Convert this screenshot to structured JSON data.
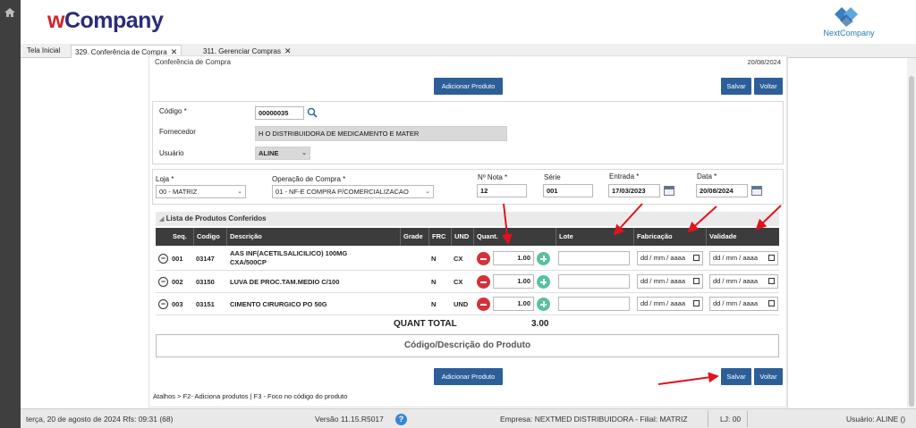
{
  "header": {
    "logo_w": "w",
    "logo_company": "Company",
    "brand_right": "NextCompany"
  },
  "tabs": [
    {
      "label": "Tela Inicial"
    },
    {
      "label": "329. Conferência de Compra"
    },
    {
      "label": "311. Gerenciar Compras"
    }
  ],
  "page": {
    "title": "Conferência de Compra",
    "date": "20/08/2024"
  },
  "buttons": {
    "add_product": "Adicionar Produto",
    "save": "Salvar",
    "back": "Voltar"
  },
  "info": {
    "codigo_label": "Código *",
    "codigo_value": "00000035",
    "fornecedor_label": "Fornecedor",
    "fornecedor_value": "H O DISTRIBUIDORA DE MEDICAMENTO E MATER",
    "usuario_label": "Usuário",
    "usuario_value": "ALINE"
  },
  "form": {
    "loja_label": "Loja *",
    "loja_value": "00 - MATRIZ",
    "operacao_label": "Operação de Compra *",
    "operacao_value": "01 - NF-E COMPRA P/COMERCIALIZACAO",
    "nota_label": "Nº Nota *",
    "nota_value": "12",
    "serie_label": "Série",
    "serie_value": "001",
    "entrada_label": "Entrada *",
    "entrada_value": "17/03/2023",
    "data_label": "Data *",
    "data_value": "20/08/2024"
  },
  "list": {
    "title": "Lista de Produtos Conferidos",
    "columns": [
      "Seq.",
      "Codigo",
      "Descrição",
      "Grade",
      "FRC",
      "UND",
      "Quant.",
      "Lote",
      "Fabricação",
      "Validade"
    ],
    "rows": [
      {
        "seq": "001",
        "codigo": "03147",
        "descricao": "AAS INF(ACETILSALICILICO) 100MG CXA/500CP",
        "frc": "N",
        "und": "CX",
        "quant": "1.00",
        "fabricacao": "dd / mm / aaaa",
        "validade": "dd / mm / aaaa"
      },
      {
        "seq": "002",
        "codigo": "03150",
        "descricao": "LUVA DE PROC.TAM.MEDIO C/100",
        "frc": "N",
        "und": "CX",
        "quant": "1.00",
        "fabricacao": "dd / mm / aaaa",
        "validade": "dd / mm / aaaa"
      },
      {
        "seq": "003",
        "codigo": "03151",
        "descricao": "CIMENTO CIRURGICO PO 50G",
        "frc": "N",
        "und": "UND",
        "quant": "1.00",
        "fabricacao": "dd / mm / aaaa",
        "validade": "dd / mm / aaaa"
      }
    ],
    "total_label": "QUANT TOTAL",
    "total_value": "3.00",
    "search_placeholder": "Código/Descrição do Produto"
  },
  "shortcuts": "Atalhos > F2- Adiciona produtos | F3 - Foco no código do produto",
  "status": {
    "datetime": "terça, 20 de agosto de 2024  Rfs: 09:31 (68)",
    "version": "Versão 11.15.R5017",
    "company": "Empresa: NEXTMED DISTRIBUIDORA - Filial: MATRIZ",
    "lj": "LJ: 00",
    "user": "Usuário: ALINE ()"
  },
  "colors": {
    "primary_button": "#2c5f98",
    "annotation_arrow": "#e0141e",
    "remove": "#d6303b",
    "add": "#59c0a2"
  }
}
